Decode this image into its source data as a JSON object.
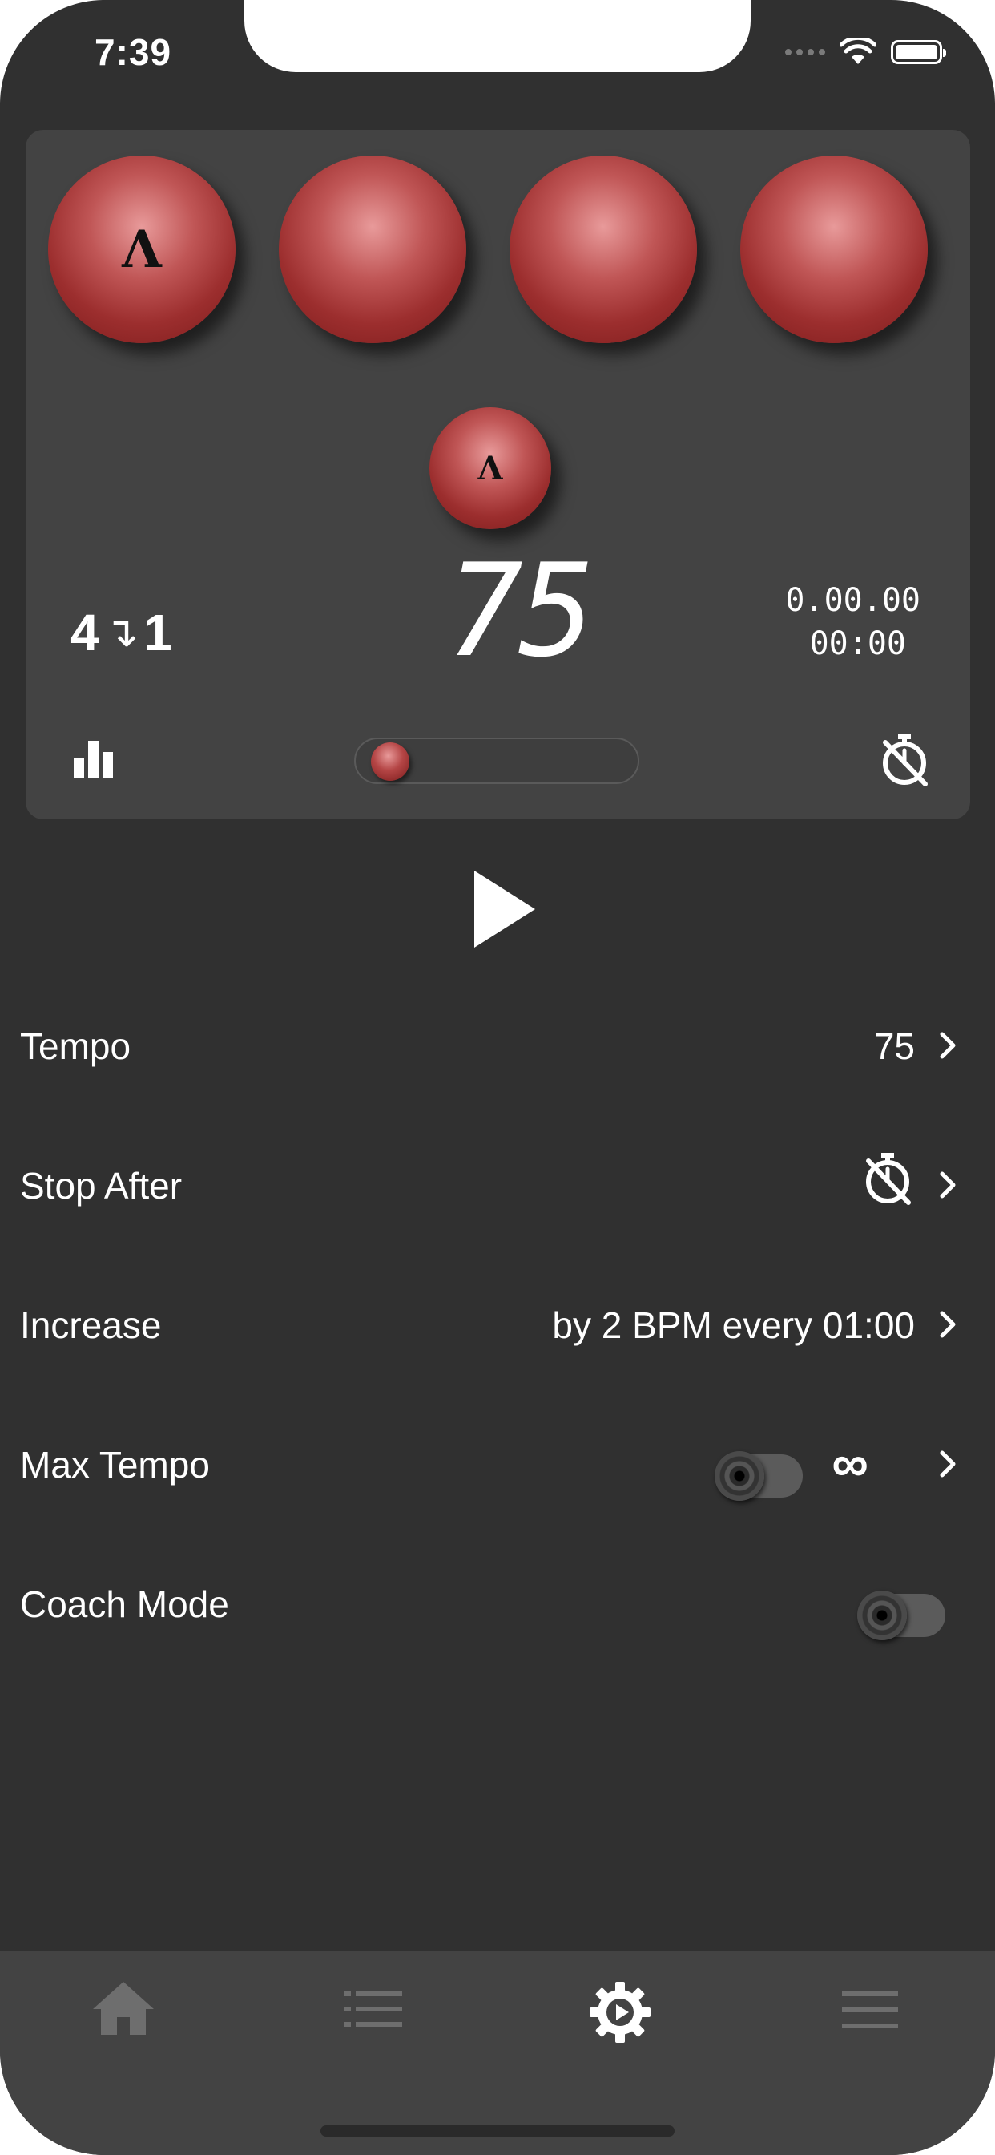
{
  "status_bar": {
    "time": "7:39"
  },
  "metronome": {
    "beat_marker": "Λ",
    "accent_marker": "Λ",
    "beats_count": 4,
    "time_signature": {
      "from": "4",
      "arrow": "↴",
      "to": "1"
    },
    "tempo_display": "75",
    "timer": {
      "line1": "0.00.00",
      "line2": "00:00"
    },
    "volume_level": 0.05
  },
  "settings": {
    "tempo": {
      "label": "Tempo",
      "value": "75"
    },
    "stop_after": {
      "label": "Stop After"
    },
    "increase": {
      "label": "Increase",
      "value": "by 2 BPM every 01:00"
    },
    "max_tempo": {
      "label": "Max Tempo",
      "value": "∞",
      "enabled": false
    },
    "coach_mode": {
      "label": "Coach Mode",
      "enabled": false
    }
  },
  "tab_bar": {
    "items": [
      {
        "icon": "home-icon",
        "active": false
      },
      {
        "icon": "list-icon",
        "active": false
      },
      {
        "icon": "gear-play-icon",
        "active": true
      },
      {
        "icon": "menu-icon",
        "active": false
      }
    ]
  },
  "colors": {
    "background": "#303030",
    "panel": "#434343",
    "ball": "#a83a3a",
    "inactive_icon": "#6e6e6e"
  }
}
